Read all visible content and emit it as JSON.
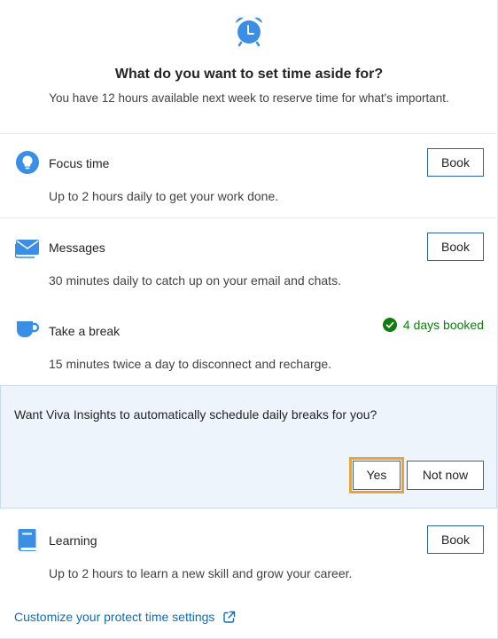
{
  "header": {
    "title": "What do you want to set time aside for?",
    "subtitle": "You have 12 hours available next week to reserve time for what's important."
  },
  "items": [
    {
      "icon": "lightbulb-icon",
      "title": "Focus time",
      "description": "Up to 2 hours daily to get your work done.",
      "action_label": "Book"
    },
    {
      "icon": "envelope-icon",
      "title": "Messages",
      "description": "30 minutes daily to catch up on your email and chats.",
      "action_label": "Book"
    },
    {
      "icon": "coffee-cup-icon",
      "title": "Take a break",
      "description": "15 minutes twice a day to disconnect and recharge.",
      "status": "4 days booked"
    },
    {
      "icon": "book-icon",
      "title": "Learning",
      "description": "Up to 2 hours to learn a new skill and grow your career.",
      "action_label": "Book"
    }
  ],
  "prompt": {
    "text": "Want Viva Insights to automatically schedule daily breaks for you?",
    "yes_label": "Yes",
    "no_label": "Not now"
  },
  "footer": {
    "link_label": "Customize your protect time settings"
  },
  "colors": {
    "accent": "#0f6cbd",
    "icon_blue": "#3a8ee6",
    "success": "#107c10",
    "highlight": "#e8a33b",
    "prompt_bg": "#eef4fb"
  }
}
